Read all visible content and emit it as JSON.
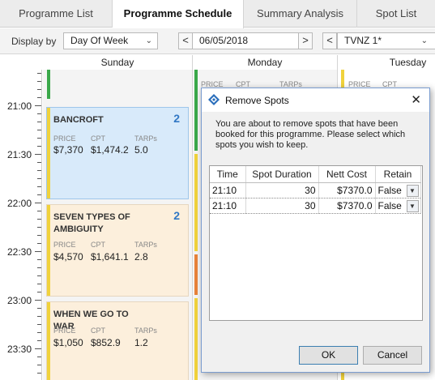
{
  "tabs": [
    {
      "label": "Programme List",
      "active": false
    },
    {
      "label": "Programme Schedule",
      "active": true
    },
    {
      "label": "Summary Analysis",
      "active": false
    },
    {
      "label": "Spot List",
      "active": false
    }
  ],
  "toolbar": {
    "display_by_label": "Display by",
    "display_by_value": "Day Of Week",
    "prev_symbol": "<",
    "next_symbol": ">",
    "date": "06/05/2018",
    "channel": "TVNZ 1*"
  },
  "days": [
    "Sunday",
    "Monday",
    "Tuesday"
  ],
  "times": [
    "21:00",
    "21:30",
    "22:00",
    "22:30",
    "23:00",
    "23:30"
  ],
  "programmes": [
    {
      "title": "BANCROFT",
      "count": "2",
      "price_label": "PRICE",
      "price": "$7,370",
      "cpt_label": "CPT",
      "cpt": "$1,474.2",
      "tarps_label": "TARPs",
      "tarps": "5.0",
      "selected": true
    },
    {
      "title": "SEVEN TYPES OF AMBIGUITY",
      "count": "2",
      "price_label": "PRICE",
      "price": "$4,570",
      "cpt_label": "CPT",
      "cpt": "$1,641.1",
      "tarps_label": "TARPs",
      "tarps": "2.8",
      "selected": false
    },
    {
      "title": "WHEN WE GO TO WAR",
      "count": "",
      "price_label": "PRICE",
      "price": "$1,050",
      "cpt_label": "CPT",
      "cpt": "$852.9",
      "tarps_label": "TARPs",
      "tarps": "1.2",
      "selected": false
    }
  ],
  "monday_partial": {
    "price": "PRICE",
    "cpt": "CPT",
    "tarps": "TARPs"
  },
  "dialog": {
    "title": "Remove Spots",
    "message": "You are about to remove spots that have been booked for this programme. Please select which spots you wish to keep.",
    "columns": [
      "Time",
      "Spot Duration",
      "Nett Cost",
      "Retain"
    ],
    "rows": [
      {
        "time": "21:10",
        "duration": "30",
        "cost": "$7370.0",
        "retain": "False"
      },
      {
        "time": "21:10",
        "duration": "30",
        "cost": "$7370.0",
        "retain": "False"
      }
    ],
    "ok_label": "OK",
    "cancel_label": "Cancel"
  },
  "colors": {
    "accent": "#3177c4",
    "selected_bg": "#d8eafa",
    "programme_bg": "#fcefdc",
    "stripe_yellow": "#f0d23c",
    "stripe_green": "#3aa84a",
    "stripe_orange": "#e8823a"
  }
}
